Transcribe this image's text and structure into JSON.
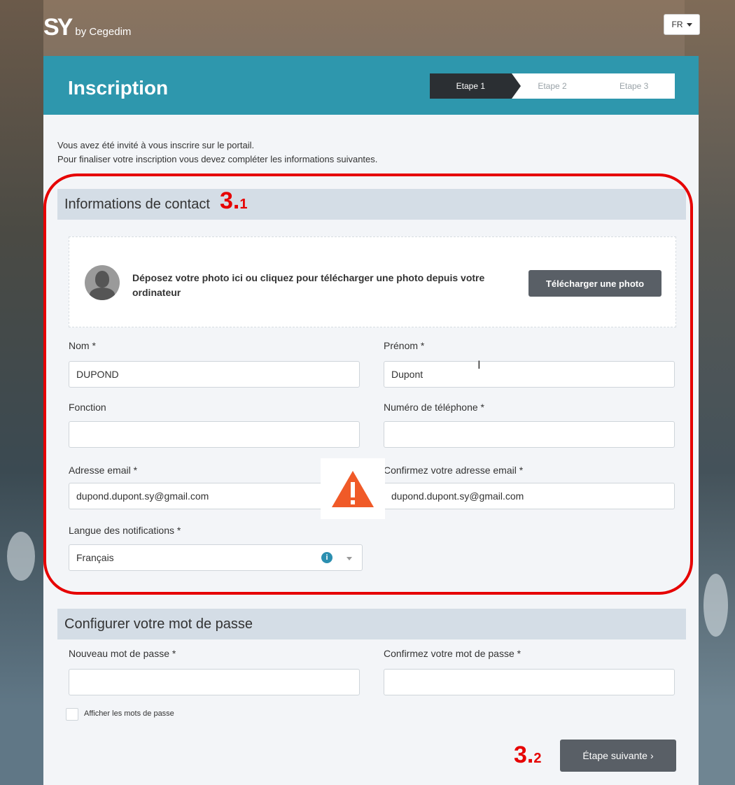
{
  "logo": {
    "brand": "SY",
    "by": "by Cegedim"
  },
  "lang_button": {
    "label": "FR",
    "icon": "chevron-down-icon"
  },
  "header": {
    "title": "Inscription",
    "steps": [
      {
        "label": "Etape 1",
        "active": true
      },
      {
        "label": "Etape 2",
        "active": false
      },
      {
        "label": "Etape 3",
        "active": false
      }
    ]
  },
  "intro": {
    "line1": "Vous avez été invité à vous inscrire sur le portail.",
    "line2": "Pour finaliser votre inscription vous devez compléter les informations suivantes."
  },
  "contact": {
    "section_title": "Informations de contact",
    "annotation_big": "3.",
    "annotation_small": "1",
    "dropzone_text": "Déposez votre photo ici ou cliquez pour télécharger une photo depuis votre ordinateur",
    "upload_button": "Télécharger une photo",
    "nom": {
      "label": "Nom *",
      "value": "DUPOND"
    },
    "prenom": {
      "label": "Prénom *",
      "value": "Dupont"
    },
    "fonction": {
      "label": "Fonction",
      "value": ""
    },
    "telephone": {
      "label": "Numéro de téléphone *",
      "value": ""
    },
    "email": {
      "label": "Adresse email *",
      "value": "dupond.dupont.sy@gmail.com"
    },
    "email_confirm": {
      "label": "Confirmez votre adresse email *",
      "value": "dupond.dupont.sy@gmail.com"
    },
    "langue": {
      "label": "Langue des notifications *",
      "value": "Français",
      "info_icon": "info-icon"
    }
  },
  "password": {
    "section_title": "Configurer votre mot de passe",
    "new": {
      "label": "Nouveau mot de passe *",
      "value": ""
    },
    "confirm": {
      "label": "Confirmez votre mot de passe *",
      "value": ""
    },
    "show_label": "Afficher les mots de passe"
  },
  "footer": {
    "annotation_big": "3.",
    "annotation_small": "2",
    "next_button": "Étape suivante",
    "next_chevron": "›"
  },
  "colors": {
    "header": "#2e97ad",
    "annotation": "#e60000",
    "warning": "#f05a28",
    "button": "#595f66"
  }
}
